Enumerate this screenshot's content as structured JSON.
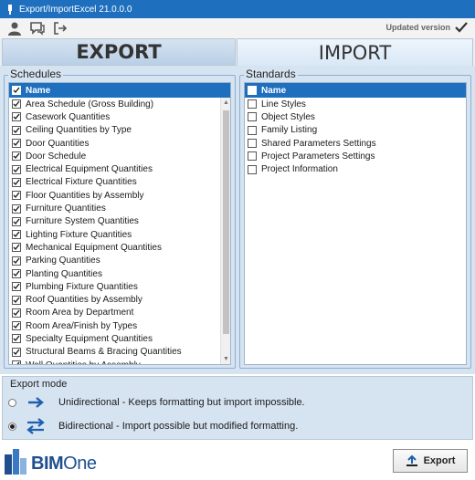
{
  "window": {
    "title": "Export/ImportExcel 21.0.0.0"
  },
  "toolbar": {
    "updated_label": "Updated version"
  },
  "tabs": {
    "export_label": "EXPORT",
    "import_label": "IMPORT"
  },
  "schedules": {
    "group_label": "Schedules",
    "header": "Name",
    "items": [
      "Area Schedule (Gross Building)",
      "Casework Quantities",
      "Ceiling Quantities by Type",
      "Door Quantities",
      "Door Schedule",
      "Electrical Equipment Quantities",
      "Electrical Fixture Quantities",
      "Floor Quantities by Assembly",
      "Furniture Quantities",
      "Furniture System Quantities",
      "Lighting Fixture Quantities",
      "Mechanical Equipment Quantities",
      "Parking Quantities",
      "Planting Quantities",
      "Plumbing Fixture Quantities",
      "Roof Quantities by Assembly",
      "Room Area by Department",
      "Room Area/Finish by Types",
      "Specialty Equipment Quantities",
      "Structural Beams & Bracing Quantities",
      "Wall Quantities by Assembly"
    ]
  },
  "standards": {
    "group_label": "Standards",
    "header": "Name",
    "items": [
      "Line Styles",
      "Object Styles",
      "Family Listing",
      "Shared Parameters Settings",
      "Project Parameters Settings",
      "Project Information"
    ]
  },
  "export_mode": {
    "label": "Export mode",
    "unidirectional": "Unidirectional - Keeps formatting but import impossible.",
    "bidirectional": "Bidirectional - Import possible but modified formatting.",
    "selected": "bidirectional"
  },
  "footer": {
    "logo_bim": "BIM",
    "logo_one": "One",
    "export_button": "Export"
  },
  "colors": {
    "accent": "#1f6fbf",
    "panel": "#d6e4f2"
  }
}
